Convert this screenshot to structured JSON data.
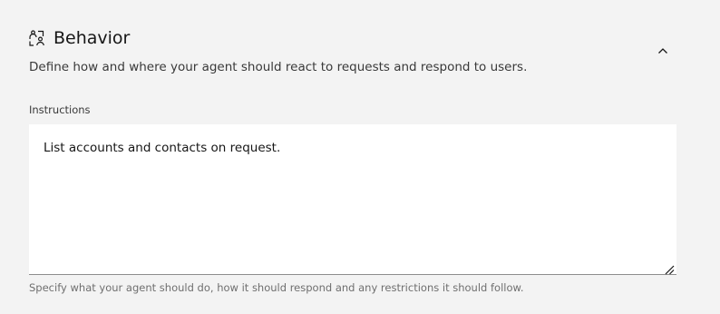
{
  "section": {
    "icon": "agent-behavior-icon",
    "title": "Behavior",
    "description": "Define how and where your agent should react to requests and respond to users.",
    "collapse_icon": "chevron-up-icon"
  },
  "instructions": {
    "label": "Instructions",
    "value": "List accounts and contacts on request.",
    "helper": "Specify what your agent should do, how it should respond and any restrictions it should follow."
  }
}
